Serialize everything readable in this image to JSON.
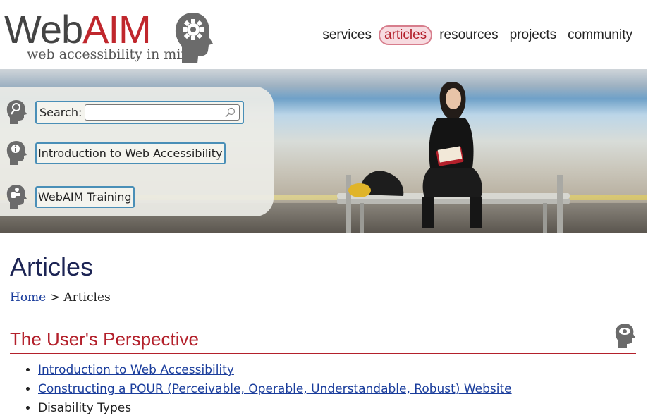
{
  "logo": {
    "word_web": "Web",
    "word_aim": "AIM",
    "tagline": "web accessibility in mind"
  },
  "nav": {
    "items": [
      {
        "label": "services",
        "active": false
      },
      {
        "label": "articles",
        "active": true
      },
      {
        "label": "resources",
        "active": false
      },
      {
        "label": "projects",
        "active": false
      },
      {
        "label": "community",
        "active": false
      }
    ]
  },
  "banner": {
    "search": {
      "label": "Search:",
      "value": "",
      "placeholder": ""
    },
    "links": [
      "Introduction to Web Accessibility",
      "WebAIM Training"
    ]
  },
  "page": {
    "title": "Articles"
  },
  "breadcrumb": {
    "home": "Home",
    "separator": ">",
    "current": "Articles"
  },
  "section": {
    "title": "The User's Perspective",
    "items": [
      {
        "label": "Introduction to Web Accessibility",
        "link": true
      },
      {
        "label": "Constructing a POUR (Perceivable, Operable, Understandable, Robust) Website",
        "link": true
      },
      {
        "label": "Disability Types",
        "link": false
      }
    ]
  },
  "colors": {
    "brand_red": "#c0272d",
    "link_blue": "#1a3d9c",
    "title_navy": "#1c2454",
    "focus_blue": "#4a8fb7"
  },
  "icons": [
    "gear-head-icon",
    "search-head-icon",
    "info-head-icon",
    "training-head-icon",
    "search-glass-icon",
    "eye-head-icon"
  ]
}
